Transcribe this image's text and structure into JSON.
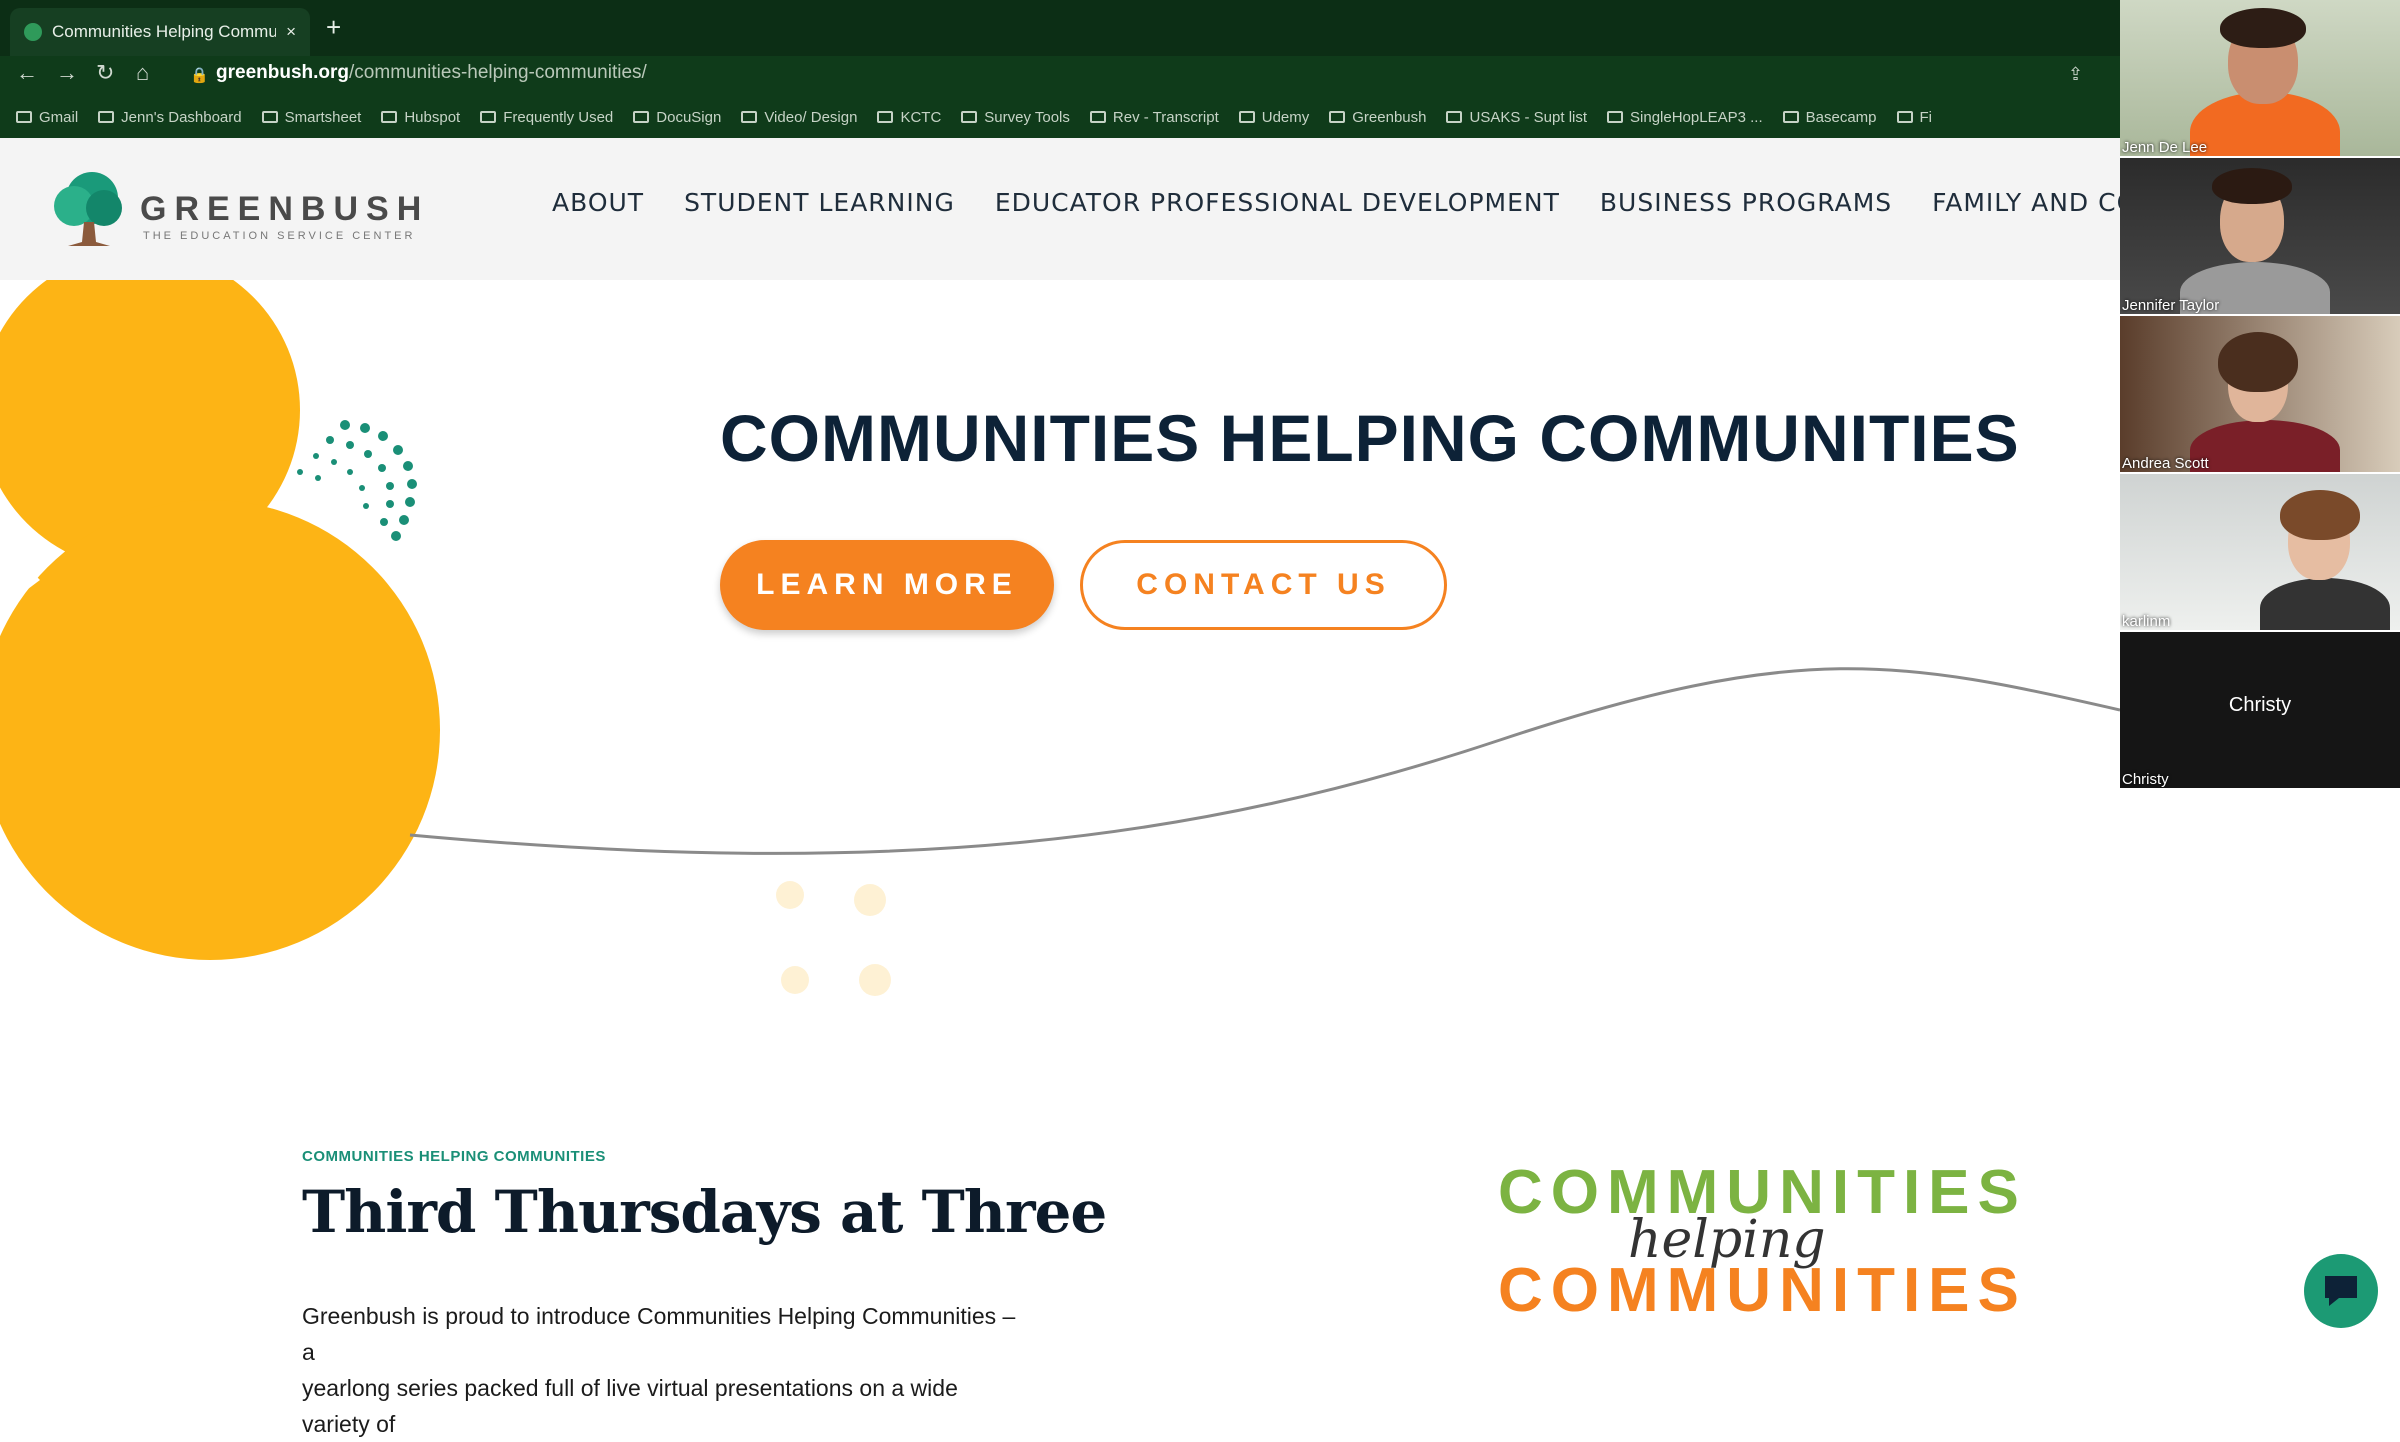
{
  "browser": {
    "tab_title": "Communities Helping Commun",
    "tab_close": "×",
    "new_tab": "+",
    "url_host": "greenbush.org",
    "url_path": "/communities-helping-communities/",
    "bookmarks": [
      "Gmail",
      "Jenn's Dashboard",
      "Smartsheet",
      "Hubspot",
      "Frequently Used",
      "DocuSign",
      "Video/ Design",
      "KCTC",
      "Survey Tools",
      "Rev - Transcript",
      "Udemy",
      "Greenbush",
      "USAKS - Supt list",
      "SingleHopLEAP3 ...",
      "Basecamp",
      "Fi"
    ]
  },
  "site": {
    "logo_word": "GREENBUSH",
    "logo_tagline": "THE EDUCATION SERVICE CENTER",
    "nav": [
      "ABOUT",
      "STUDENT LEARNING",
      "EDUCATOR PROFESSIONAL DEVELOPMENT",
      "BUSINESS PROGRAMS",
      "FAMILY AND COMMUNITY PROGRAMS"
    ],
    "hero_title": "COMMUNITIES HELPING COMMUNITIES",
    "learn_more": "LEARN MORE",
    "contact_us": "CONTACT US",
    "eyebrow": "COMMUNITIES HELPING COMMUNITIES",
    "section_title": "Third Thursdays at Three",
    "intro_line1": "Greenbush is proud to introduce Communities Helping Communities – a",
    "intro_line2": "yearlong series packed full of live virtual presentations on a wide variety of",
    "logo_line1": "COMMUNITIES",
    "logo_helping": "helping",
    "logo_line2": "COMMUNITIES"
  },
  "participants": [
    {
      "name": "Jenn De Lee"
    },
    {
      "name": "Jennifer Taylor"
    },
    {
      "name": "Andrea Scott"
    },
    {
      "name": "karlinm"
    },
    {
      "name": "Christy",
      "center_label": "Christy"
    }
  ],
  "colors": {
    "brand_orange": "#f58220",
    "brand_yellow": "#fdb415",
    "brand_green": "#1a8f77",
    "navy": "#0d2237"
  }
}
